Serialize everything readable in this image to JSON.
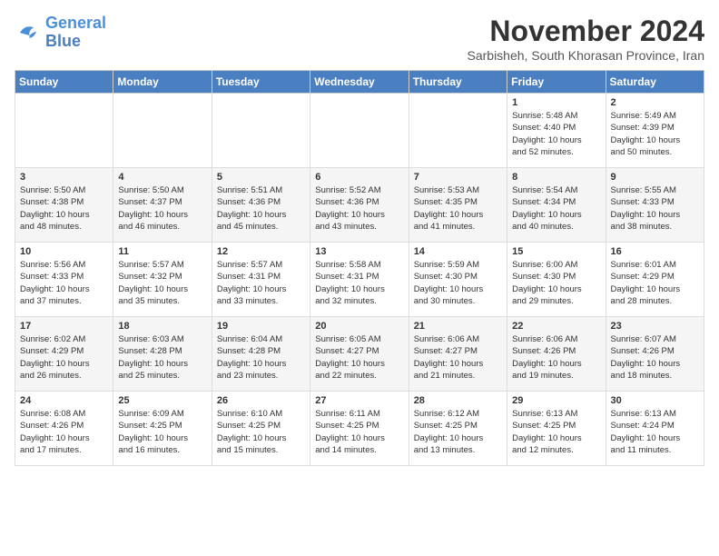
{
  "header": {
    "logo_line1": "General",
    "logo_line2": "Blue",
    "month": "November 2024",
    "location": "Sarbisheh, South Khorasan Province, Iran"
  },
  "days_of_week": [
    "Sunday",
    "Monday",
    "Tuesday",
    "Wednesday",
    "Thursday",
    "Friday",
    "Saturday"
  ],
  "weeks": [
    [
      {
        "day": "",
        "info": ""
      },
      {
        "day": "",
        "info": ""
      },
      {
        "day": "",
        "info": ""
      },
      {
        "day": "",
        "info": ""
      },
      {
        "day": "",
        "info": ""
      },
      {
        "day": "1",
        "info": "Sunrise: 5:48 AM\nSunset: 4:40 PM\nDaylight: 10 hours\nand 52 minutes."
      },
      {
        "day": "2",
        "info": "Sunrise: 5:49 AM\nSunset: 4:39 PM\nDaylight: 10 hours\nand 50 minutes."
      }
    ],
    [
      {
        "day": "3",
        "info": "Sunrise: 5:50 AM\nSunset: 4:38 PM\nDaylight: 10 hours\nand 48 minutes."
      },
      {
        "day": "4",
        "info": "Sunrise: 5:50 AM\nSunset: 4:37 PM\nDaylight: 10 hours\nand 46 minutes."
      },
      {
        "day": "5",
        "info": "Sunrise: 5:51 AM\nSunset: 4:36 PM\nDaylight: 10 hours\nand 45 minutes."
      },
      {
        "day": "6",
        "info": "Sunrise: 5:52 AM\nSunset: 4:36 PM\nDaylight: 10 hours\nand 43 minutes."
      },
      {
        "day": "7",
        "info": "Sunrise: 5:53 AM\nSunset: 4:35 PM\nDaylight: 10 hours\nand 41 minutes."
      },
      {
        "day": "8",
        "info": "Sunrise: 5:54 AM\nSunset: 4:34 PM\nDaylight: 10 hours\nand 40 minutes."
      },
      {
        "day": "9",
        "info": "Sunrise: 5:55 AM\nSunset: 4:33 PM\nDaylight: 10 hours\nand 38 minutes."
      }
    ],
    [
      {
        "day": "10",
        "info": "Sunrise: 5:56 AM\nSunset: 4:33 PM\nDaylight: 10 hours\nand 37 minutes."
      },
      {
        "day": "11",
        "info": "Sunrise: 5:57 AM\nSunset: 4:32 PM\nDaylight: 10 hours\nand 35 minutes."
      },
      {
        "day": "12",
        "info": "Sunrise: 5:57 AM\nSunset: 4:31 PM\nDaylight: 10 hours\nand 33 minutes."
      },
      {
        "day": "13",
        "info": "Sunrise: 5:58 AM\nSunset: 4:31 PM\nDaylight: 10 hours\nand 32 minutes."
      },
      {
        "day": "14",
        "info": "Sunrise: 5:59 AM\nSunset: 4:30 PM\nDaylight: 10 hours\nand 30 minutes."
      },
      {
        "day": "15",
        "info": "Sunrise: 6:00 AM\nSunset: 4:30 PM\nDaylight: 10 hours\nand 29 minutes."
      },
      {
        "day": "16",
        "info": "Sunrise: 6:01 AM\nSunset: 4:29 PM\nDaylight: 10 hours\nand 28 minutes."
      }
    ],
    [
      {
        "day": "17",
        "info": "Sunrise: 6:02 AM\nSunset: 4:29 PM\nDaylight: 10 hours\nand 26 minutes."
      },
      {
        "day": "18",
        "info": "Sunrise: 6:03 AM\nSunset: 4:28 PM\nDaylight: 10 hours\nand 25 minutes."
      },
      {
        "day": "19",
        "info": "Sunrise: 6:04 AM\nSunset: 4:28 PM\nDaylight: 10 hours\nand 23 minutes."
      },
      {
        "day": "20",
        "info": "Sunrise: 6:05 AM\nSunset: 4:27 PM\nDaylight: 10 hours\nand 22 minutes."
      },
      {
        "day": "21",
        "info": "Sunrise: 6:06 AM\nSunset: 4:27 PM\nDaylight: 10 hours\nand 21 minutes."
      },
      {
        "day": "22",
        "info": "Sunrise: 6:06 AM\nSunset: 4:26 PM\nDaylight: 10 hours\nand 19 minutes."
      },
      {
        "day": "23",
        "info": "Sunrise: 6:07 AM\nSunset: 4:26 PM\nDaylight: 10 hours\nand 18 minutes."
      }
    ],
    [
      {
        "day": "24",
        "info": "Sunrise: 6:08 AM\nSunset: 4:26 PM\nDaylight: 10 hours\nand 17 minutes."
      },
      {
        "day": "25",
        "info": "Sunrise: 6:09 AM\nSunset: 4:25 PM\nDaylight: 10 hours\nand 16 minutes."
      },
      {
        "day": "26",
        "info": "Sunrise: 6:10 AM\nSunset: 4:25 PM\nDaylight: 10 hours\nand 15 minutes."
      },
      {
        "day": "27",
        "info": "Sunrise: 6:11 AM\nSunset: 4:25 PM\nDaylight: 10 hours\nand 14 minutes."
      },
      {
        "day": "28",
        "info": "Sunrise: 6:12 AM\nSunset: 4:25 PM\nDaylight: 10 hours\nand 13 minutes."
      },
      {
        "day": "29",
        "info": "Sunrise: 6:13 AM\nSunset: 4:25 PM\nDaylight: 10 hours\nand 12 minutes."
      },
      {
        "day": "30",
        "info": "Sunrise: 6:13 AM\nSunset: 4:24 PM\nDaylight: 10 hours\nand 11 minutes."
      }
    ]
  ]
}
